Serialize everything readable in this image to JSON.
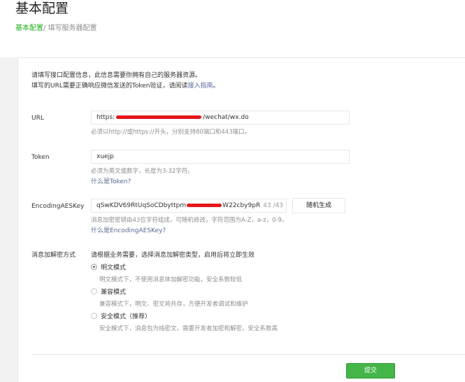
{
  "header": {
    "title": "基本配置",
    "breadcrumb": {
      "link": "基本配置",
      "separator": "/ ",
      "current": "填写服务器配置"
    }
  },
  "intro": {
    "line1": "请填写接口配置信息，此信息需要你拥有自己的服务器资源。",
    "line2_prefix": "填写的URL需要正确响应微信发送的Token验证，请阅读",
    "line2_link": "接入指南",
    "line2_suffix": "。"
  },
  "url": {
    "label": "URL",
    "value_prefix": "https:",
    "value_suffix": "/wechat/wx.do",
    "hint": "必须以http://或https://开头，分别支持80端口和443端口。"
  },
  "token": {
    "label": "Token",
    "value": "xuejp",
    "hint": "必须为英文或数字，长度为3-32字符。",
    "help_link": "什么是Token?"
  },
  "aeskey": {
    "label": "EncodingAESKey",
    "value_prefix": "qSwKDV69RtUqSoCDbyttpm",
    "value_suffix": "W22cby9pR",
    "counter": "43 /43",
    "generate_label": "随机生成",
    "hint": "消息加密密钥由43位字符组成，可随机修改，字符范围为A-Z，a-z，0-9。",
    "help_link": "什么是EncodingAESKey?"
  },
  "encryption": {
    "label": "消息加解密方式",
    "description": "请根据业务需要，选择消息加解密类型，启用后将立即生效",
    "options": [
      {
        "label": "明文模式",
        "desc": "明文模式下，不使用消息体加解密功能，安全系数较低",
        "checked": true
      },
      {
        "label": "兼容模式",
        "desc": "兼容模式下，明文、密文将共存，方便开发者调试和维护",
        "checked": false
      },
      {
        "label": "安全模式（推荐）",
        "desc": "安全模式下，消息包为纯密文，需要开发者加密和解密，安全系数高",
        "checked": false
      }
    ]
  },
  "footer": {
    "submit_label": "提交"
  },
  "colors": {
    "accent": "#44b549",
    "link": "#576b95",
    "redaction": "#e5161a"
  }
}
